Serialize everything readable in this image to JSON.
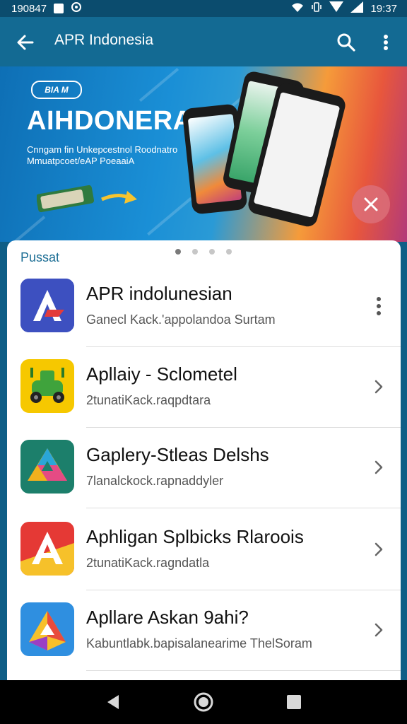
{
  "status_bar": {
    "left_text": "190847",
    "time": "19:37",
    "icons": [
      "photo-icon",
      "settings-icon",
      "wifi-icon",
      "vibrate-icon",
      "signal-icon",
      "battery-icon"
    ]
  },
  "app_bar": {
    "title": "APR Indonesia",
    "icons": [
      "back-arrow-icon",
      "search-icon",
      "more-vertical-icon"
    ]
  },
  "banner": {
    "badge": "BIA M",
    "headline": "AIHDONERA",
    "tagline_line1": "Cnngam fin Unkepcestnol Roodnatro",
    "tagline_line2": "Mmuatpcoet/eAP PoeaaiA",
    "dismiss_icon": "close-icon",
    "colors": {
      "blue": "#1a8fd6",
      "orange": "#f59b3a",
      "red": "#e8573c",
      "purple": "#b23a7a"
    }
  },
  "list": {
    "section_title": "Pussat",
    "carousel_pages": 4,
    "carousel_active": 1,
    "items": [
      {
        "name": "APR indolunesian",
        "subtitle": "Ganecl Kack.'appolandoa Surtam",
        "icon": "apr-app-icon",
        "action": "more-options-icon"
      },
      {
        "name": "Apllaiy - Sclometel",
        "subtitle": "2tunatiKack.raqpdtara",
        "icon": "robot-car-app-icon",
        "action": "chevron-right-icon"
      },
      {
        "name": "Gaplery-Stleas Delshs",
        "subtitle": "7lanalckock.rapnaddyler",
        "icon": "play-triangle-app-icon",
        "action": "chevron-right-icon"
      },
      {
        "name": "Aphligan Splbicks Rlaroois",
        "subtitle": "2tunatiKack.ragndatla",
        "icon": "red-a-app-icon",
        "action": "chevron-right-icon"
      },
      {
        "name": "Apllare Askan 9ahi?",
        "subtitle": "Kabuntlabk.bapisalanearime ThelSoram",
        "icon": "gem-app-icon",
        "action": "chevron-right-icon"
      }
    ]
  },
  "nav_bar": {
    "icons": [
      "back-triangle-icon",
      "home-circle-icon",
      "recents-square-icon"
    ]
  }
}
